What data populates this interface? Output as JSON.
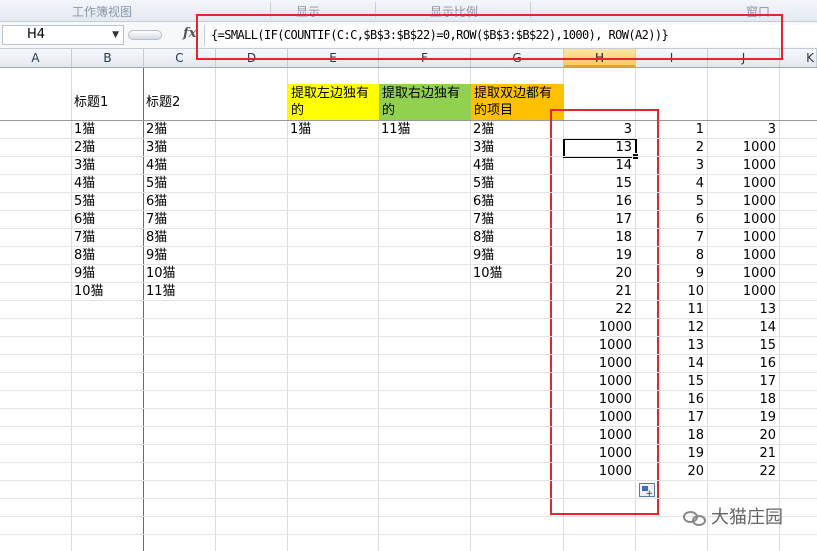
{
  "ribbon": {
    "groups": [
      "工作簿视图",
      "显示",
      "显示比例",
      "窗口"
    ]
  },
  "formula_bar": {
    "name_box": "H4",
    "fx_label": "fx",
    "formula": "{=SMALL(IF(COUNTIF(C:C,$B$3:$B$22)=0,ROW($B$3:$B$22),1000), ROW(A2))}"
  },
  "columns": [
    "A",
    "B",
    "C",
    "D",
    "E",
    "F",
    "G",
    "H",
    "I",
    "J",
    "K"
  ],
  "selected_column": "H",
  "headers": {
    "b": "标题1",
    "c": "标题2",
    "e": "提取左边独有的",
    "f": "提取右边独有的",
    "g": "提取双边都有的项目"
  },
  "colors": {
    "yellow": "#ffff00",
    "green": "#92d050",
    "orange": "#ffc000",
    "highlight_red": "#e5242b"
  },
  "col_b": [
    "1猫",
    "2猫",
    "3猫",
    "4猫",
    "5猫",
    "6猫",
    "7猫",
    "8猫",
    "9猫",
    "10猫"
  ],
  "col_c": [
    "2猫",
    "3猫",
    "4猫",
    "5猫",
    "6猫",
    "7猫",
    "8猫",
    "9猫",
    "10猫",
    "11猫"
  ],
  "col_e": [
    "1猫"
  ],
  "col_f": [
    "11猫"
  ],
  "col_g": [
    "2猫",
    "3猫",
    "4猫",
    "5猫",
    "6猫",
    "7猫",
    "8猫",
    "9猫",
    "10猫"
  ],
  "col_h": [
    "3",
    "13",
    "14",
    "15",
    "16",
    "17",
    "18",
    "19",
    "20",
    "21",
    "22",
    "1000",
    "1000",
    "1000",
    "1000",
    "1000",
    "1000",
    "1000",
    "1000",
    "1000"
  ],
  "col_i": [
    "1",
    "2",
    "3",
    "4",
    "5",
    "6",
    "7",
    "8",
    "9",
    "10",
    "11",
    "12",
    "13",
    "14",
    "15",
    "16",
    "17",
    "18",
    "19",
    "20"
  ],
  "col_j": [
    "3",
    "1000",
    "1000",
    "1000",
    "1000",
    "1000",
    "1000",
    "1000",
    "1000",
    "1000",
    "13",
    "14",
    "15",
    "16",
    "17",
    "18",
    "19",
    "20",
    "21",
    "22"
  ],
  "watermark": "大猫庄园"
}
